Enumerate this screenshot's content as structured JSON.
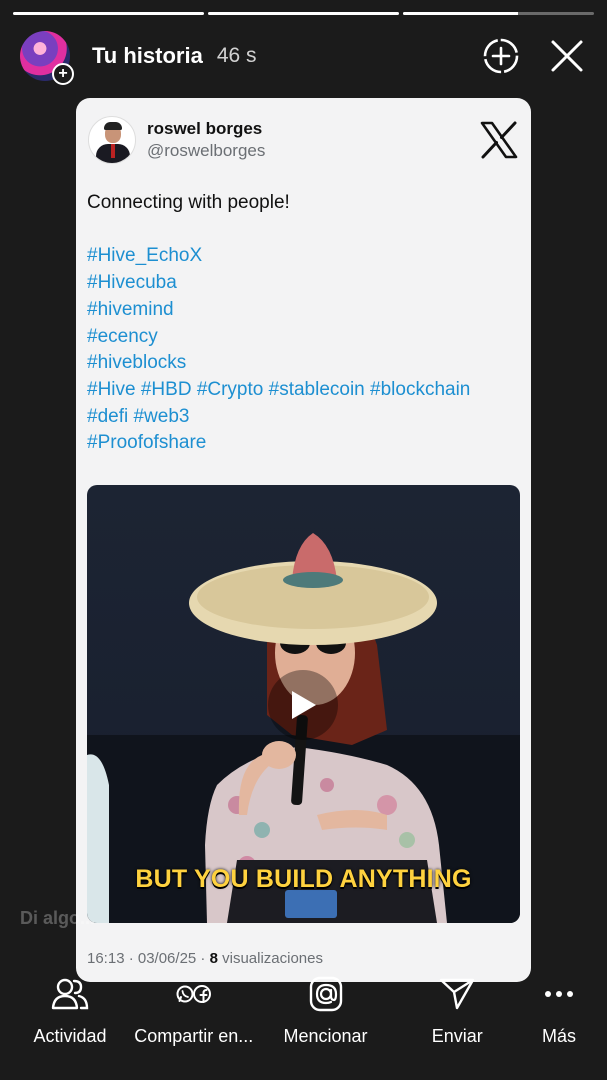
{
  "story": {
    "title": "Tu historia",
    "time": "46 s",
    "segments": [
      1.0,
      1.0,
      0.6
    ],
    "reply_placeholder": "Di algo..."
  },
  "tweet": {
    "name": "roswel borges",
    "handle": "@roswelborges",
    "text": "Connecting with people!",
    "hashtag_lines": [
      "#Hive_EchoX",
      "#Hivecuba",
      "#hivemind",
      "#ecency",
      "#hiveblocks",
      "#Hive #HBD #Crypto #stablecoin #blockchain",
      "#defi #web3",
      "#Proofofshare"
    ],
    "video_caption": "BUT YOU BUILD ANYTHING",
    "meta_prefix": "16:13 · 03/06/25 · ",
    "views": "8",
    "views_label": " visualizaciones"
  },
  "actions": [
    {
      "label": "Actividad",
      "icon": "people-icon"
    },
    {
      "label": "Compartir en...",
      "icon": "share-apps-icon"
    },
    {
      "label": "Mencionar",
      "icon": "mention-icon"
    },
    {
      "label": "Enviar",
      "icon": "send-icon"
    },
    {
      "label": "Más",
      "icon": "more-icon"
    }
  ],
  "colors": {
    "background": "#1b1b1b",
    "card": "#f3f3f4",
    "hashtag": "#1d8fd1",
    "caption": "#ffd23f"
  }
}
